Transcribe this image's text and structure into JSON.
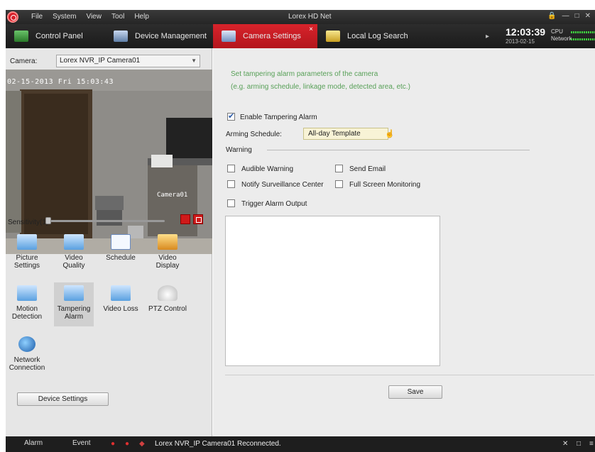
{
  "titlebar": {
    "menu": [
      "File",
      "System",
      "View",
      "Tool",
      "Help"
    ],
    "title": "Lorex HD Net",
    "controls": [
      "lock-icon",
      "minimize-icon",
      "maximize-icon",
      "close-icon"
    ]
  },
  "tabs": [
    {
      "label": "Control Panel",
      "icon": "control-panel-icon"
    },
    {
      "label": "Device Management",
      "icon": "device-management-icon"
    },
    {
      "label": "Camera Settings",
      "icon": "camera-settings-icon",
      "active": true
    },
    {
      "label": "Local Log Search",
      "icon": "log-search-icon"
    }
  ],
  "clock": {
    "time": "12:03:39",
    "date": "2013-02-15"
  },
  "system": {
    "cpu_label": "CPU",
    "network_label": "Network"
  },
  "camera": {
    "label": "Camera:",
    "selected": "Lorex NVR_IP Camera01",
    "osd_time": "02-15-2013 Fri 15:03:43",
    "osd_name": "Camera01"
  },
  "sensitivity": {
    "label": "Sensitivity(1)",
    "value": 1
  },
  "functions": [
    {
      "label": "Picture Settings",
      "icon": "picture-settings-icon"
    },
    {
      "label": "Video Quality",
      "icon": "video-quality-icon"
    },
    {
      "label": "Schedule",
      "icon": "schedule-icon"
    },
    {
      "label": "Video Display",
      "icon": "video-display-icon"
    },
    {
      "label": "Motion Detection",
      "icon": "motion-detection-icon"
    },
    {
      "label": "Tampering Alarm",
      "icon": "tampering-alarm-icon",
      "active": true
    },
    {
      "label": "Video Loss",
      "icon": "video-loss-icon"
    },
    {
      "label": "PTZ Control",
      "icon": "ptz-control-icon"
    },
    {
      "label": "Network Connection",
      "icon": "network-connection-icon"
    }
  ],
  "device_settings_label": "Device Settings",
  "panel": {
    "hint_line1": "Set tampering alarm parameters of the camera",
    "hint_line2": "(e.g. arming schedule, linkage mode, detected area, etc.)",
    "enable_label": "Enable Tampering Alarm",
    "enable_checked": true,
    "arming_label": "Arming Schedule:",
    "arming_value": "All-day Template",
    "warning_label": "Warning",
    "audible": "Audible Warning",
    "send_email": "Send Email",
    "notify_center": "Notify Surveillance Center",
    "full_screen": "Full Screen Monitoring",
    "trigger_output": "Trigger Alarm Output",
    "save_label": "Save"
  },
  "statusbar": {
    "alarm_tab": "Alarm",
    "event_tab": "Event",
    "message": "Lorex NVR_IP Camera01 Reconnected."
  },
  "colors": {
    "accent": "#c81e26",
    "hint": "#58a058"
  }
}
